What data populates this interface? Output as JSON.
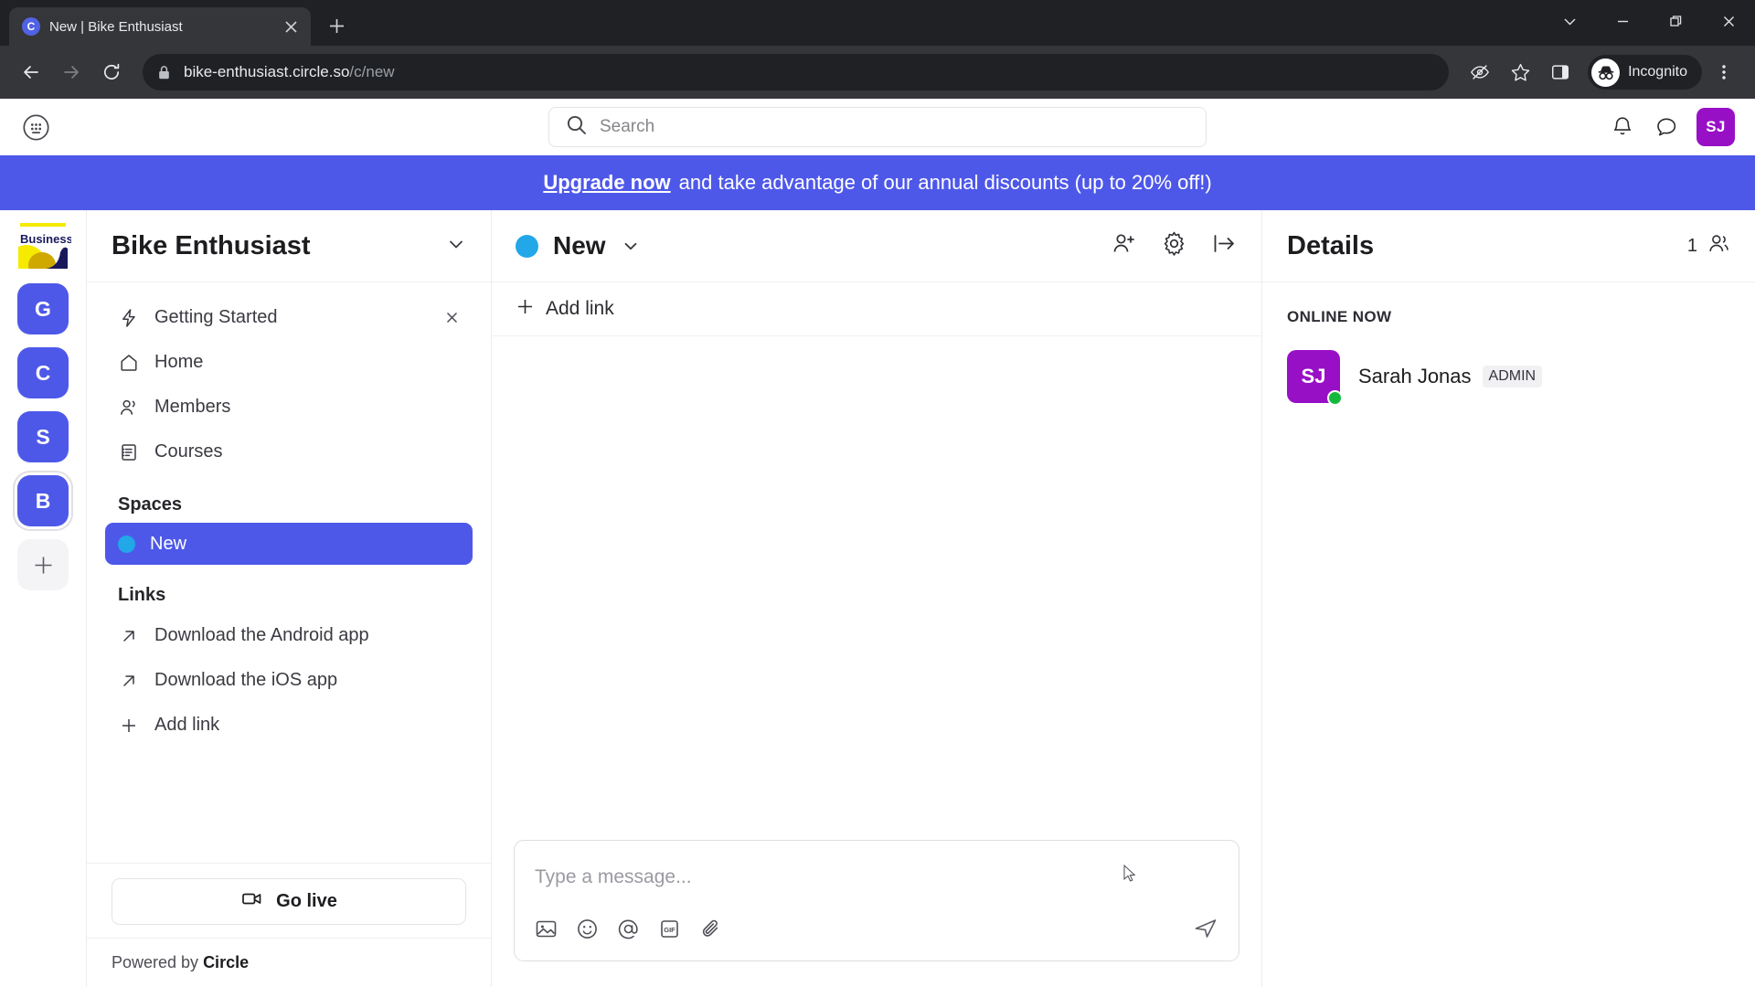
{
  "browser": {
    "tab": {
      "title": "New | Bike Enthusiast",
      "favicon_letter": "C",
      "close_icon": "close-icon"
    },
    "new_tab_icon": "plus-icon",
    "window": {
      "minimize": "minimize-icon",
      "maximize": "maximize-icon",
      "close": "close-icon",
      "chevron": "chevron-down-icon"
    },
    "nav": {
      "back": "back-arrow-icon",
      "forward": "forward-arrow-icon",
      "reload": "reload-icon"
    },
    "omnibox": {
      "lock_icon": "lock-icon",
      "url_main": "bike-enthusiast.circle.so",
      "url_path": "/c/new"
    },
    "toolbar_right": {
      "tracking_icon": "eye-slash-icon",
      "bookmark_icon": "star-icon",
      "sidepanel_icon": "side-panel-icon",
      "incognito_label": "Incognito",
      "menu_icon": "three-dot-menu-icon"
    }
  },
  "app_header": {
    "apps_icon": "grid-dots-icon",
    "search": {
      "placeholder": "Search",
      "icon": "search-icon"
    },
    "notifications_icon": "bell-icon",
    "messages_icon": "chat-bubble-icon",
    "avatar_initials": "SJ"
  },
  "banner": {
    "link_text": "Upgrade now",
    "rest_text": "and take advantage of our annual discounts (up to 20% off!)",
    "bg_color": "#4e58e8"
  },
  "rail": {
    "brand_word": "Business",
    "communities": [
      {
        "letter": "G",
        "selected": false
      },
      {
        "letter": "C",
        "selected": false
      },
      {
        "letter": "S",
        "selected": false
      },
      {
        "letter": "B",
        "selected": true
      }
    ],
    "add_label": "+"
  },
  "sidebar": {
    "title": "Bike Enthusiast",
    "chevron_icon": "chevron-down-icon",
    "nav": [
      {
        "label": "Getting Started",
        "icon": "lightning-bolt-icon",
        "dismissible": true
      },
      {
        "label": "Home",
        "icon": "home-icon",
        "dismissible": false
      },
      {
        "label": "Members",
        "icon": "people-icon",
        "dismissible": false
      },
      {
        "label": "Courses",
        "icon": "course-list-icon",
        "dismissible": false
      }
    ],
    "spaces_label": "Spaces",
    "spaces": [
      {
        "label": "New",
        "active": true,
        "dot_color": "#22a7e8"
      }
    ],
    "links_label": "Links",
    "links": [
      {
        "label": "Download the Android app",
        "icon": "external-link-arrow-icon"
      },
      {
        "label": "Download the iOS app",
        "icon": "external-link-arrow-icon"
      },
      {
        "label": "Add link",
        "icon": "plus-icon"
      }
    ],
    "go_live_label": "Go live",
    "go_live_icon": "video-camera-icon",
    "powered_by_prefix": "Powered by ",
    "powered_by_brand": "Circle"
  },
  "main": {
    "space_title": "New",
    "space_dot_color": "#22a7e8",
    "chevron_icon": "chevron-down-icon",
    "actions": {
      "invite_icon": "add-person-icon",
      "settings_icon": "gear-icon",
      "collapse_icon": "collapse-panel-icon"
    },
    "add_link_label": "Add link",
    "add_link_icon": "plus-icon",
    "composer": {
      "placeholder": "Type a message...",
      "tools": [
        "image-icon",
        "emoji-icon",
        "mention-icon",
        "gif-icon",
        "attachment-icon"
      ],
      "send_icon": "send-icon"
    }
  },
  "details": {
    "title": "Details",
    "member_count": "1",
    "members_icon": "people-icon",
    "section_label": "ONLINE NOW",
    "members": [
      {
        "initials": "SJ",
        "name": "Sarah Jonas",
        "badge": "ADMIN",
        "online": true,
        "avatar_color": "#9810c6"
      }
    ]
  }
}
